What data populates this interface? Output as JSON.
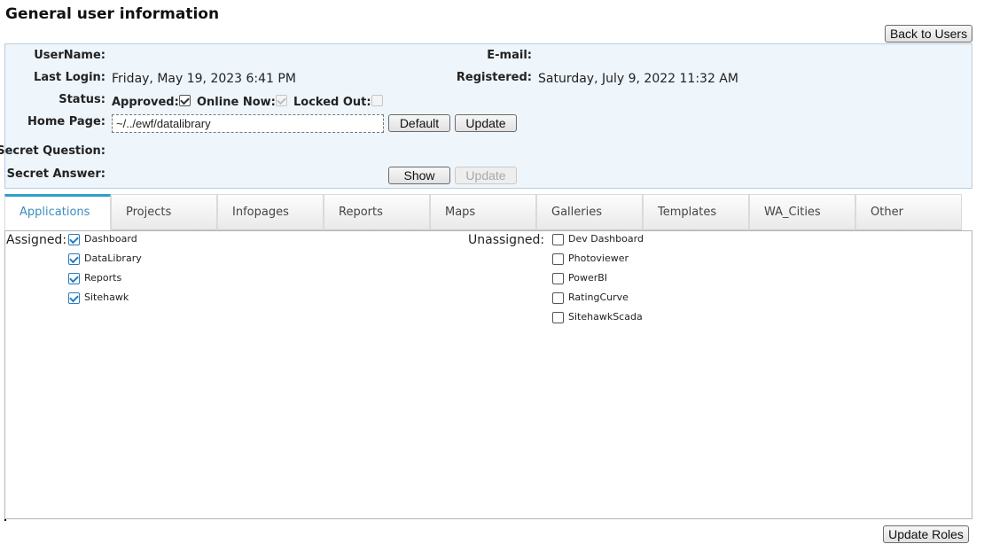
{
  "page": {
    "title": "General user information"
  },
  "actions": {
    "back_to_users": "Back to Users",
    "update_roles": "Update Roles"
  },
  "info": {
    "username_label": "UserName:",
    "username_value": "",
    "email_label": "E-mail:",
    "email_value": "",
    "last_login_label": "Last Login:",
    "last_login_value": "Friday, May 19, 2023 6:41 PM",
    "registered_label": "Registered:",
    "registered_value": "Saturday, July 9, 2022 11:32 AM",
    "status_label": "Status:",
    "approved_label": "Approved:",
    "approved_checked": true,
    "online_now_label": "Online Now:",
    "online_now_checked": true,
    "locked_out_label": "Locked Out:",
    "locked_out_checked": false,
    "home_page_label": "Home Page:",
    "home_page_value": "~/../ewf/datalibrary",
    "default_button": "Default",
    "update_button": "Update",
    "secret_question_label": "Secret Question:",
    "secret_question_value": "",
    "secret_answer_label": "Secret Answer:",
    "secret_answer_value": "",
    "show_button": "Show",
    "update_secret_button": "Update"
  },
  "tabs": [
    {
      "label": "Applications",
      "active": true
    },
    {
      "label": "Projects",
      "active": false
    },
    {
      "label": "Infopages",
      "active": false
    },
    {
      "label": "Reports",
      "active": false
    },
    {
      "label": "Maps",
      "active": false
    },
    {
      "label": "Galleries",
      "active": false
    },
    {
      "label": "Templates",
      "active": false
    },
    {
      "label": "WA_Cities",
      "active": false
    },
    {
      "label": "Other",
      "active": false
    }
  ],
  "roles": {
    "assigned_label": "Assigned:",
    "unassigned_label": "Unassigned:",
    "assigned": [
      {
        "label": "Dashboard",
        "checked": true
      },
      {
        "label": "DataLibrary",
        "checked": true
      },
      {
        "label": "Reports",
        "checked": true
      },
      {
        "label": "Sitehawk",
        "checked": true
      }
    ],
    "unassigned": [
      {
        "label": "Dev Dashboard",
        "checked": false
      },
      {
        "label": "Photoviewer",
        "checked": false
      },
      {
        "label": "PowerBI",
        "checked": false
      },
      {
        "label": "RatingCurve",
        "checked": false
      },
      {
        "label": "SitehawkScada",
        "checked": false
      }
    ]
  }
}
